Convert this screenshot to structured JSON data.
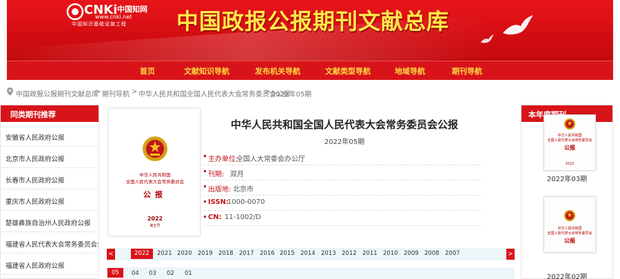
{
  "brand": {
    "logo_text": "CNKi",
    "logo_cn": "中国知网",
    "logo_url": "www.cnki.net",
    "logo_sub": "中国知识基础设施工程",
    "site_title": "中国政报公报期刊文献总库",
    "primary_color": "#d8141a",
    "title_color": "#ffe94a"
  },
  "nav": {
    "items": [
      "首页",
      "文献知识导航",
      "发布机关导航",
      "文献类型导航",
      "地域导航",
      "期刊导航"
    ]
  },
  "breadcrumb": {
    "items": [
      "中国政报公报期刊文献总库",
      "期刊导航",
      "中华人民共和国全国人民代表大会常务委员会公报",
      "2022年05期"
    ],
    "separator": ">"
  },
  "left_sidebar": {
    "title": "同类期刊推荐",
    "items": [
      "安徽省人民政府公报",
      "北京市人民政府公报",
      "长春市人民政府公报",
      "重庆市人民政府公报",
      "楚雄彝族自治州人民政府公报",
      "福建省人民代表大会常务委员会公报",
      "福建省人民政府公报"
    ]
  },
  "right_sidebar": {
    "title": "本年度期刊",
    "covers": [
      {
        "caption": "2022年03期",
        "line1": "中华人民共和国",
        "line2": "全国人民代表大会常务委员会",
        "label": "公报",
        "year": "2022"
      },
      {
        "caption": "2022年02期",
        "line1": "中华人民共和国",
        "line2": "全国人民代表大会常务委员会",
        "label": "公报",
        "year": ""
      }
    ]
  },
  "cover": {
    "line1": "中华人民共和国",
    "line2": "全国人民代表大会常务委员会",
    "label": "公报",
    "year": "2022",
    "issue": "第五号"
  },
  "journal": {
    "title": "中华人民共和国全国人民代表大会常务委员会公报",
    "issue": "2022年05期",
    "fields": [
      {
        "label": "主办单位:",
        "value": "全国人大常委会办公厅"
      },
      {
        "label": "刊期:",
        "value": "双月"
      },
      {
        "label": "出版地:",
        "value": "北京市"
      },
      {
        "label": "ISSN:",
        "value": "1000-0070"
      },
      {
        "label": "CN:",
        "value": "11-1002/D"
      }
    ]
  },
  "years": {
    "prev": "<",
    "next": ">",
    "selected": "2022",
    "list": [
      "2022",
      "2021",
      "2020",
      "2019",
      "2018",
      "2017",
      "2016",
      "2015",
      "2014",
      "2013",
      "2012",
      "2011",
      "2010",
      "2009",
      "2008",
      "2007"
    ]
  },
  "issues": {
    "selected": "05",
    "list": [
      "05",
      "04",
      "03",
      "02",
      "01"
    ]
  }
}
